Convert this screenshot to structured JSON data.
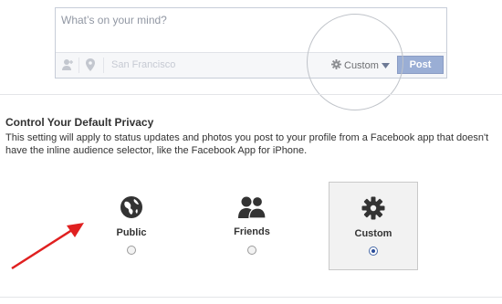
{
  "composer": {
    "placeholder": "What’s on your mind?",
    "location": "San Francisco",
    "audience_label": "Custom",
    "post_label": "Post"
  },
  "privacy": {
    "title": "Control Your Default Privacy",
    "description": "This setting will apply to status updates and photos you post to your profile from a Facebook app that doesn't have the inline audience selector, like the Facebook App for iPhone.",
    "options": [
      {
        "label": "Public",
        "icon": "globe-icon",
        "selected": false
      },
      {
        "label": "Friends",
        "icon": "friends-icon",
        "selected": false
      },
      {
        "label": "Custom",
        "icon": "gear-icon",
        "selected": true
      }
    ]
  },
  "colors": {
    "post_button": "#9aaed5",
    "arrow": "#e02020",
    "radio_selected": "#2a4c9a"
  }
}
